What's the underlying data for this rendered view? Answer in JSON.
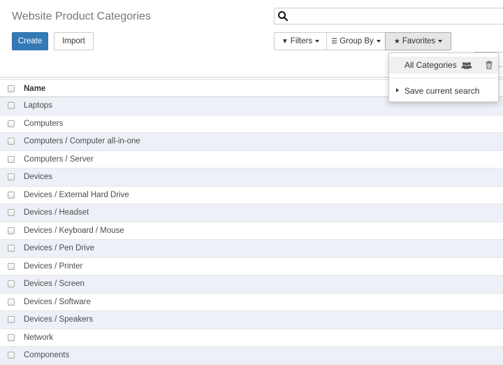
{
  "control_panel": {
    "title": "Website Product Categories",
    "create_label": "Create",
    "import_label": "Import"
  },
  "search": {
    "value": "",
    "placeholder": ""
  },
  "search_view": {
    "filters_label": "Filters",
    "group_by_label": "Group By",
    "favorites_label": "Favorites"
  },
  "favorites_menu": {
    "open": true,
    "items": [
      {
        "label": "All Categories",
        "icon": "users-icon",
        "shared": true
      }
    ],
    "save_current_search_label": "Save current search"
  },
  "list": {
    "columns": [
      "Name"
    ],
    "rows": [
      "Laptops",
      "Computers",
      "Computers / Computer all-in-one",
      "Computers / Server",
      "Devices",
      "Devices / External Hard Drive",
      "Devices / Headset",
      "Devices / Keyboard / Mouse",
      "Devices / Pen Drive",
      "Devices / Printer",
      "Devices / Screen",
      "Devices / Software",
      "Devices / Speakers",
      "Network",
      "Components"
    ]
  },
  "colors": {
    "primary": "#337ab7",
    "row_stripe": "#eef0f8"
  }
}
